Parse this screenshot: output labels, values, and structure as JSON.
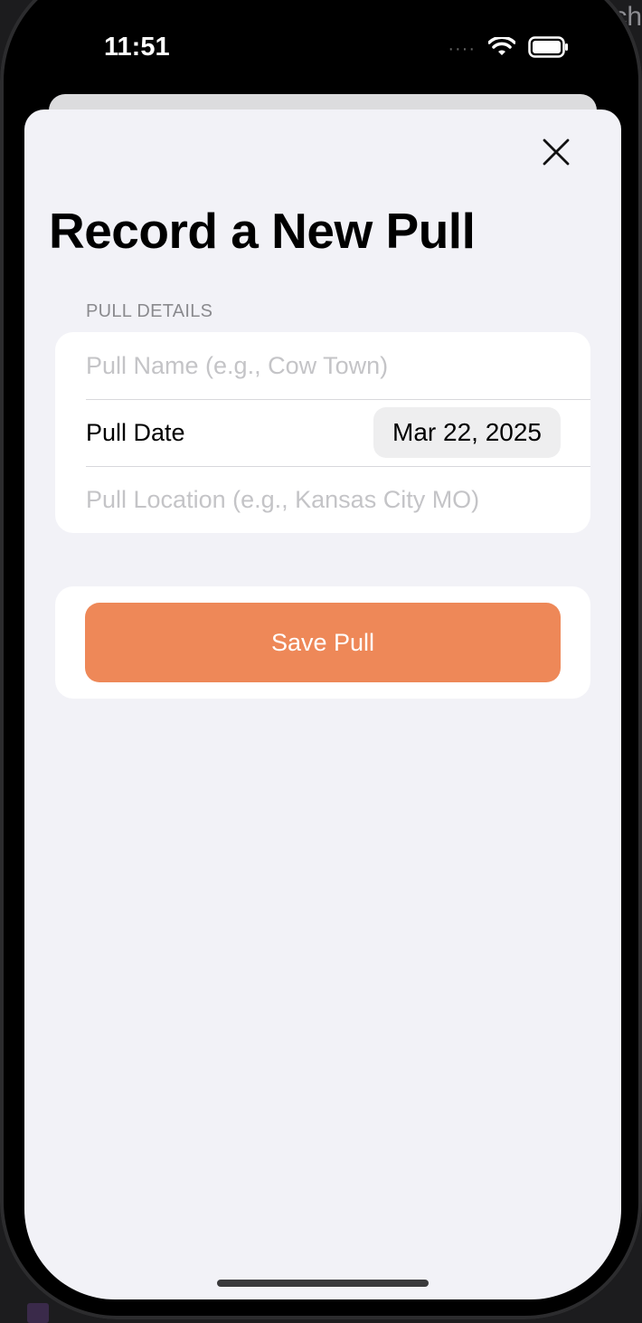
{
  "background": {
    "corner_text": "ch"
  },
  "status_bar": {
    "time": "11:51",
    "signal_dots": "····"
  },
  "sheet": {
    "title": "Record a New Pull",
    "section_header": "PULL DETAILS",
    "pull_name": {
      "value": "",
      "placeholder": "Pull Name (e.g., Cow Town)"
    },
    "pull_date": {
      "label": "Pull Date",
      "value": "Mar 22, 2025"
    },
    "pull_location": {
      "value": "",
      "placeholder": "Pull Location (e.g., Kansas City MO)"
    },
    "save_label": "Save Pull"
  },
  "colors": {
    "accent": "#ee8858",
    "sheet_bg": "#f2f2f7",
    "card_bg": "#ffffff"
  },
  "icons": {
    "close": "close-icon",
    "wifi": "wifi-icon",
    "battery": "battery-icon"
  }
}
